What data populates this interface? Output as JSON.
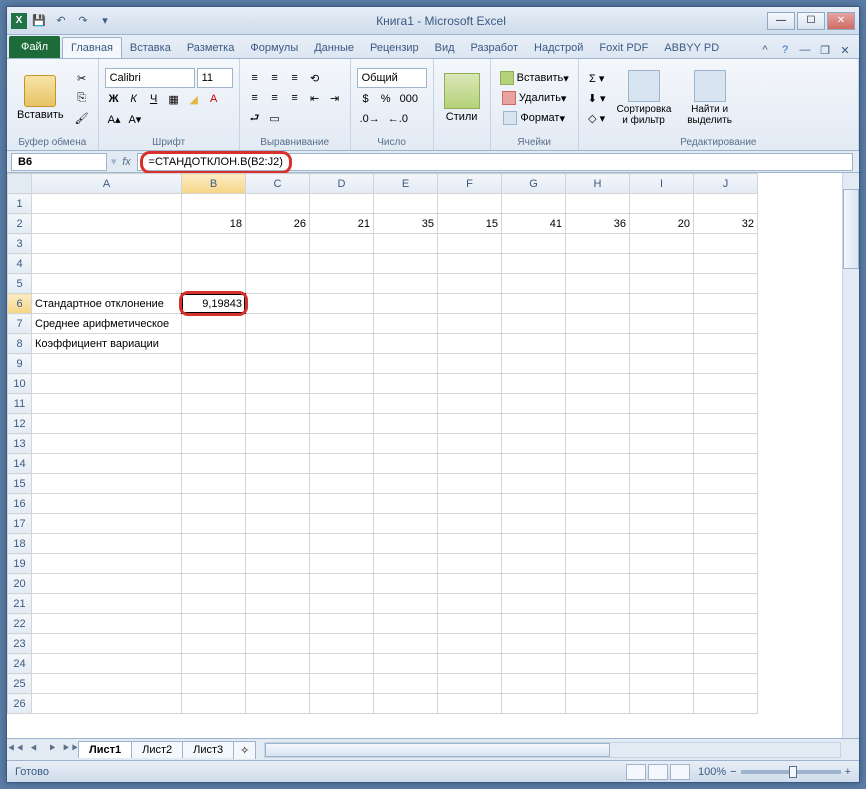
{
  "title": "Книга1 - Microsoft Excel",
  "tabs": {
    "file": "Файл",
    "list": [
      "Главная",
      "Вставка",
      "Разметка",
      "Формулы",
      "Данные",
      "Рецензир",
      "Вид",
      "Разработ",
      "Надстрой",
      "Foxit PDF",
      "ABBYY PD"
    ],
    "active": "Главная"
  },
  "ribbon": {
    "clipboard": {
      "paste": "Вставить",
      "label": "Буфер обмена"
    },
    "font": {
      "name": "Calibri",
      "size": "11",
      "label": "Шрифт"
    },
    "align": {
      "label": "Выравнивание"
    },
    "number": {
      "format": "Общий",
      "label": "Число"
    },
    "styles": {
      "btn": "Стили"
    },
    "cells": {
      "insert": "Вставить",
      "delete": "Удалить",
      "format": "Формат",
      "label": "Ячейки"
    },
    "editing": {
      "sort": "Сортировка и фильтр",
      "find": "Найти и выделить",
      "label": "Редактирование"
    }
  },
  "namebox": "B6",
  "formula": "=СТАНДОТКЛОН.В(B2:J2)",
  "columns": [
    "A",
    "B",
    "C",
    "D",
    "E",
    "F",
    "G",
    "H",
    "I",
    "J"
  ],
  "row2": [
    "",
    "18",
    "26",
    "21",
    "35",
    "15",
    "41",
    "36",
    "20",
    "32"
  ],
  "rows_labels": {
    "r6": "Стандартное отклонение",
    "r7": "Среднее арифметическое",
    "r8": "Коэффициент вариации"
  },
  "b6_value": "9,19843",
  "sheets": [
    "Лист1",
    "Лист2",
    "Лист3"
  ],
  "active_sheet": "Лист1",
  "status": "Готово",
  "zoom": "100%"
}
